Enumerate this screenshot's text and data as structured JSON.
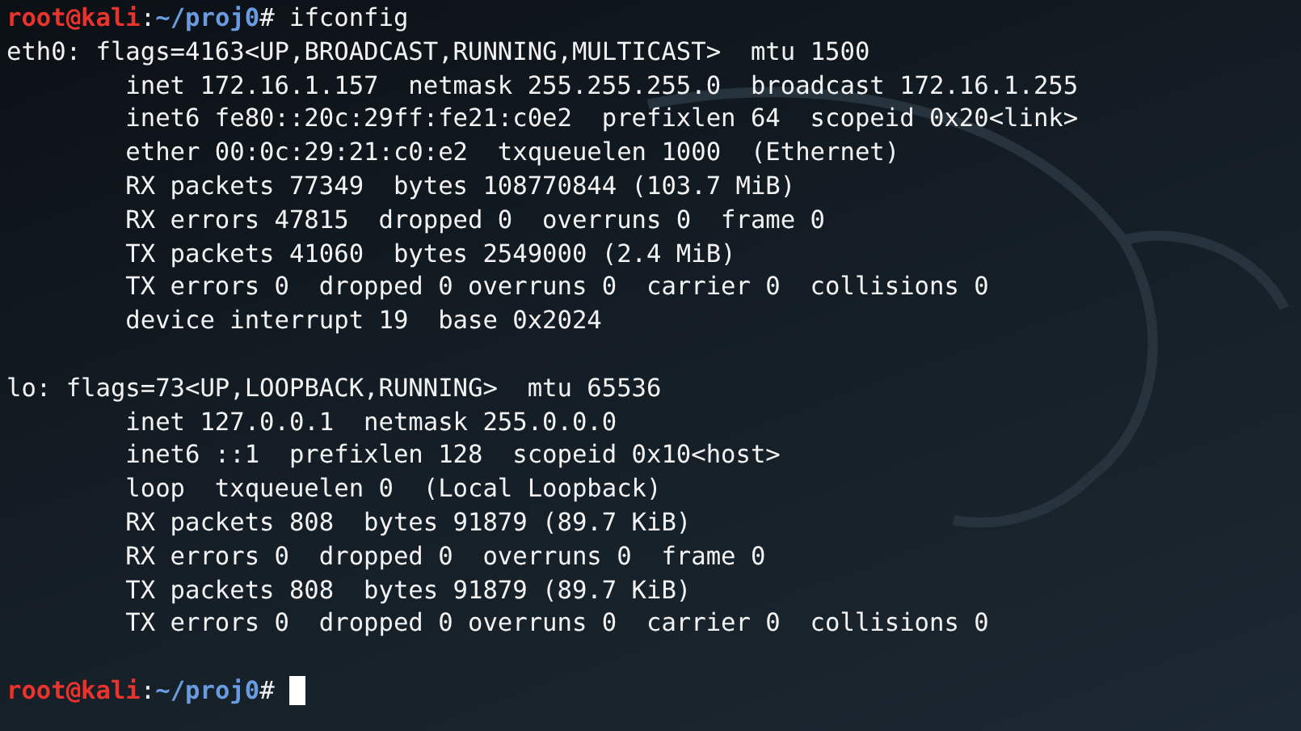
{
  "prompt": {
    "user_host": "root@kali",
    "separator": ":",
    "path": "~/proj0",
    "symbol": "#",
    "command": "ifconfig"
  },
  "interfaces": [
    {
      "header": "eth0: flags=4163<UP,BROADCAST,RUNNING,MULTICAST>  mtu 1500",
      "details": [
        "inet 172.16.1.157  netmask 255.255.255.0  broadcast 172.16.1.255",
        "inet6 fe80::20c:29ff:fe21:c0e2  prefixlen 64  scopeid 0x20<link>",
        "ether 00:0c:29:21:c0:e2  txqueuelen 1000  (Ethernet)",
        "RX packets 77349  bytes 108770844 (103.7 MiB)",
        "RX errors 47815  dropped 0  overruns 0  frame 0",
        "TX packets 41060  bytes 2549000 (2.4 MiB)",
        "TX errors 0  dropped 0 overruns 0  carrier 0  collisions 0",
        "device interrupt 19  base 0x2024"
      ]
    },
    {
      "header": "lo: flags=73<UP,LOOPBACK,RUNNING>  mtu 65536",
      "details": [
        "inet 127.0.0.1  netmask 255.0.0.0",
        "inet6 ::1  prefixlen 128  scopeid 0x10<host>",
        "loop  txqueuelen 0  (Local Loopback)",
        "RX packets 808  bytes 91879 (89.7 KiB)",
        "RX errors 0  dropped 0  overruns 0  frame 0",
        "TX packets 808  bytes 91879 (89.7 KiB)",
        "TX errors 0  dropped 0 overruns 0  carrier 0  collisions 0"
      ]
    }
  ],
  "final_prompt": {
    "user_host": "root@kali",
    "separator": ":",
    "path": "~/proj0",
    "symbol": "#",
    "cursor": true
  }
}
